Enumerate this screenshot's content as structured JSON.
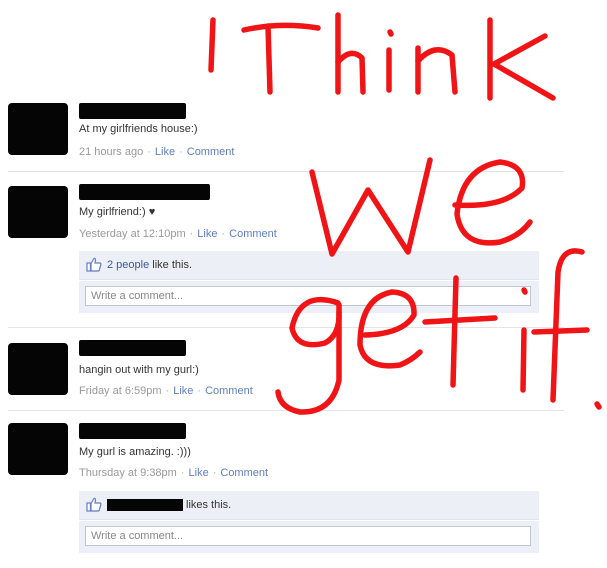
{
  "posts": [
    {
      "message": "At my girlfriends house:)",
      "time": "21 hours ago",
      "like_label": "Like",
      "comment_label": "Comment"
    },
    {
      "message": "My girlfriend:)",
      "heart": "♥",
      "time": "Yesterday at 12:10pm",
      "like_label": "Like",
      "comment_label": "Comment",
      "likes_link": "2 people",
      "likes_suffix": "like this.",
      "comment_placeholder": "Write a comment..."
    },
    {
      "message": "hangin out with my gurl:)",
      "time": "Friday at 6:59pm",
      "like_label": "Like",
      "comment_label": "Comment"
    },
    {
      "message": "My gurl is amazing. :)))",
      "time": "Thursday at 9:38pm",
      "like_label": "Like",
      "comment_label": "Comment",
      "likes_suffix": "likes this.",
      "comment_placeholder": "Write a comment..."
    }
  ],
  "handwriting": {
    "text": "I Think we get it.",
    "color": "#f01416"
  },
  "colors": {
    "link": "#5f7ec0",
    "meta": "#999999",
    "likes_bg": "#eceff5"
  },
  "icons": {
    "like": "thumbs-up-icon"
  }
}
